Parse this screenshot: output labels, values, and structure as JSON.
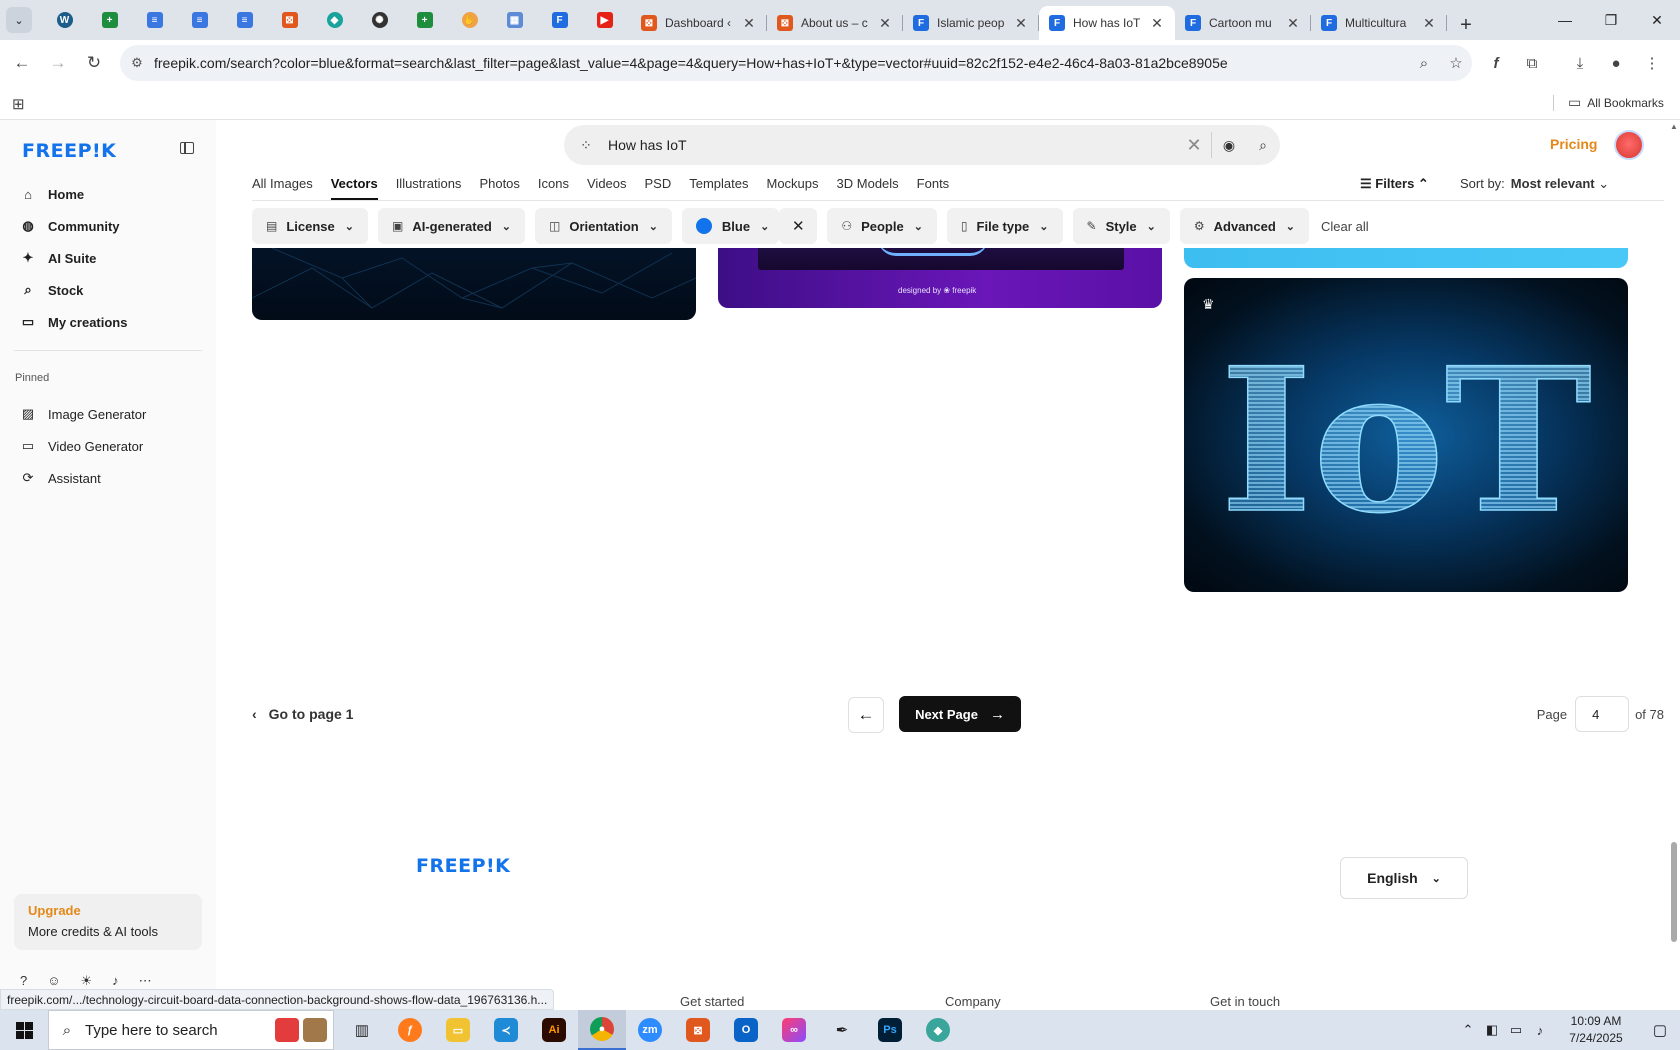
{
  "browser": {
    "tabs": [
      {
        "title": "Dashboard ‹",
        "favicon": "xampp-icon",
        "color": "#e1581f",
        "active": false
      },
      {
        "title": "About us – c",
        "favicon": "xampp-icon",
        "color": "#e1581f",
        "active": false
      },
      {
        "title": "Islamic peop",
        "favicon": "freepik-doc-icon",
        "color": "#1f6be0",
        "active": false
      },
      {
        "title": "How has IoT",
        "favicon": "freepik-doc-icon",
        "color": "#1f6be0",
        "active": true
      },
      {
        "title": "Cartoon mu",
        "favicon": "freepik-doc-icon",
        "color": "#1f6be0",
        "active": false
      },
      {
        "title": "Multicultura",
        "favicon": "freepik-doc-icon",
        "color": "#1f6be0",
        "active": false
      }
    ],
    "url": "freepik.com/search?color=blue&format=search&last_filter=page&last_value=4&page=4&query=How+has+IoT+&type=vector#uuid=82c2f152-e4e2-46c4-8a03-81a2bce8905e",
    "all_bookmarks": "All Bookmarks",
    "status_url": "freepik.com/.../technology-circuit-board-data-connection-background-shows-flow-data_196763136.h..."
  },
  "sidebar": {
    "logo": "FREEP!K",
    "nav": [
      {
        "label": "Home",
        "icon": "home-icon",
        "glyph": "⌂"
      },
      {
        "label": "Community",
        "icon": "globe-icon",
        "glyph": "◍"
      },
      {
        "label": "AI Suite",
        "icon": "sparkle-icon",
        "glyph": "✦"
      },
      {
        "label": "Stock",
        "icon": "search-icon",
        "glyph": "⌕"
      },
      {
        "label": "My creations",
        "icon": "folder-icon",
        "glyph": "▭"
      }
    ],
    "pinned_label": "Pinned",
    "pinned": [
      {
        "label": "Image Generator",
        "icon": "image-icon",
        "glyph": "▨"
      },
      {
        "label": "Video Generator",
        "icon": "video-icon",
        "glyph": "▭"
      },
      {
        "label": "Assistant",
        "icon": "chat-icon",
        "glyph": "⟳"
      }
    ],
    "upgrade_title": "Upgrade",
    "upgrade_text": "More credits & AI tools"
  },
  "search": {
    "query": "How has IoT"
  },
  "header": {
    "pricing": "Pricing"
  },
  "content_tabs": [
    "All Images",
    "Vectors",
    "Illustrations",
    "Photos",
    "Icons",
    "Videos",
    "PSD",
    "Templates",
    "Mockups",
    "3D Models",
    "Fonts"
  ],
  "active_tab": "Vectors",
  "filters_label": "Filters",
  "sort": {
    "label": "Sort by:",
    "value": "Most relevant"
  },
  "chips": [
    {
      "label": "License",
      "icon": "license-icon"
    },
    {
      "label": "AI-generated",
      "icon": "ai-generated-icon"
    },
    {
      "label": "Orientation",
      "icon": "orientation-icon"
    },
    {
      "label": "Blue",
      "icon": "color-dot",
      "color": "#1273eb"
    },
    {
      "label": "People",
      "icon": "people-icon"
    },
    {
      "label": "File type",
      "icon": "file-icon"
    },
    {
      "label": "Style",
      "icon": "brush-icon"
    },
    {
      "label": "Advanced",
      "icon": "settings-icon"
    }
  ],
  "clear_all": "Clear all",
  "gallery": {
    "credit": "designed by ❀ freepik",
    "iot_text": "IoT"
  },
  "pagination": {
    "goto_first": "Go to page 1",
    "next": "Next Page",
    "page_label": "Page",
    "current": "4",
    "total": "of 78"
  },
  "footer": {
    "logo": "FREEP!K",
    "language": "English",
    "columns": [
      "Get started",
      "Company",
      "Get in touch"
    ]
  },
  "taskbar": {
    "search_placeholder": "Type here to search",
    "time": "10:09 AM",
    "date": "7/24/2025"
  }
}
